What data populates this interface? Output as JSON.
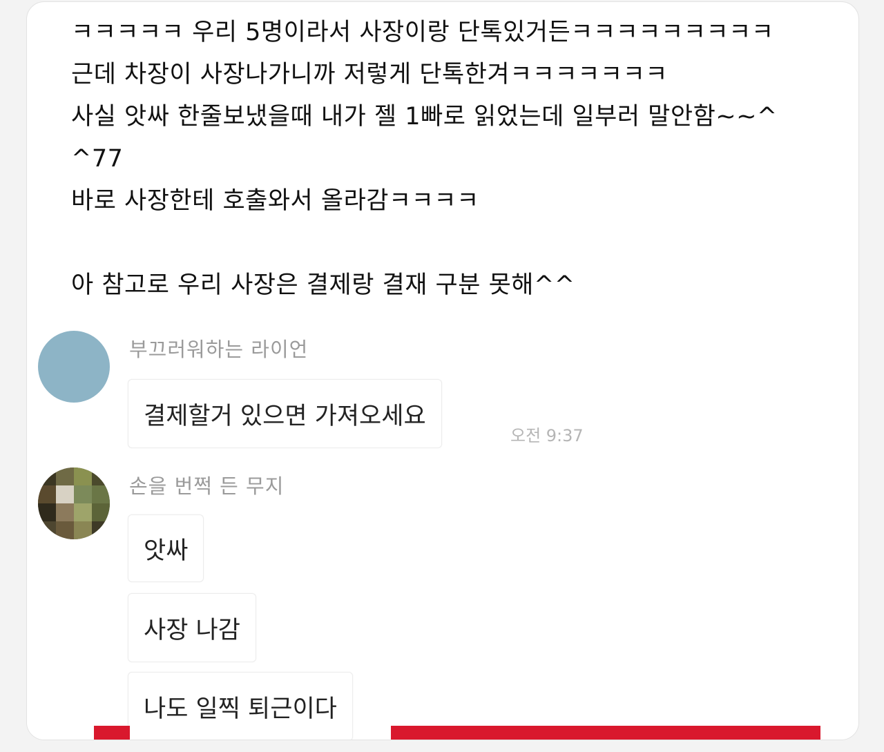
{
  "post": {
    "lines": [
      "ㅋㅋㅋㅋㅋ 우리 5명이라서 사장이랑 단톡있거든ㅋㅋㅋㅋㅋㅋㅋㅋㅋ",
      "근데 차장이 사장나가니까 저렇게 단톡한겨ㅋㅋㅋㅋㅋㅋㅋ",
      "사실 앗싸 한줄보냈을때 내가 젤 1빠로 읽었는데 일부러 말안함~~^",
      "^77",
      "바로 사장한테 호출와서 올라감ㅋㅋㅋㅋ",
      "",
      "아 참고로 우리 사장은 결제랑 결재 구분 못해^^"
    ]
  },
  "chat": {
    "messages": [
      {
        "sender": "부끄러워하는 라이언",
        "text": "결제할거 있으면 가져오세요",
        "time": "오전 9:37"
      },
      {
        "sender": "손을 번쩍 든 무지",
        "texts": [
          "앗싸",
          "사장 나감",
          "나도 일찍 퇴근이다"
        ]
      }
    ]
  },
  "colors": {
    "avatar_1": "#8db4c6",
    "accent_bar": "#d9182d"
  },
  "icons": {
    "avatar_1": "plain-circle-avatar",
    "avatar_2": "pixelated-photo-avatar"
  }
}
